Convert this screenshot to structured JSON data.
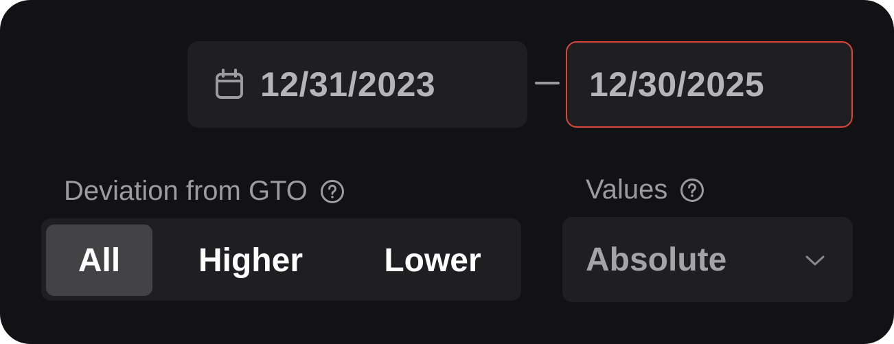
{
  "date_range": {
    "start": "12/31/2023",
    "end": "12/30/2025",
    "separator_icon": "dash-icon",
    "start_icon": "calendar-icon",
    "end_state": "error"
  },
  "deviation": {
    "label": "Deviation from GTO",
    "help_icon": "question-circle-icon",
    "options": [
      "All",
      "Higher",
      "Lower"
    ],
    "selected": "All"
  },
  "values": {
    "label": "Values",
    "help_icon": "question-circle-icon",
    "selected": "Absolute",
    "dropdown_icon": "chevron-down-icon"
  },
  "colors": {
    "background": "#121214",
    "control_bg": "#1f1f22",
    "selected_segment": "#434346",
    "error_border": "#d9463c",
    "text_primary": "#ffffff",
    "text_secondary": "#9c9ca0"
  }
}
